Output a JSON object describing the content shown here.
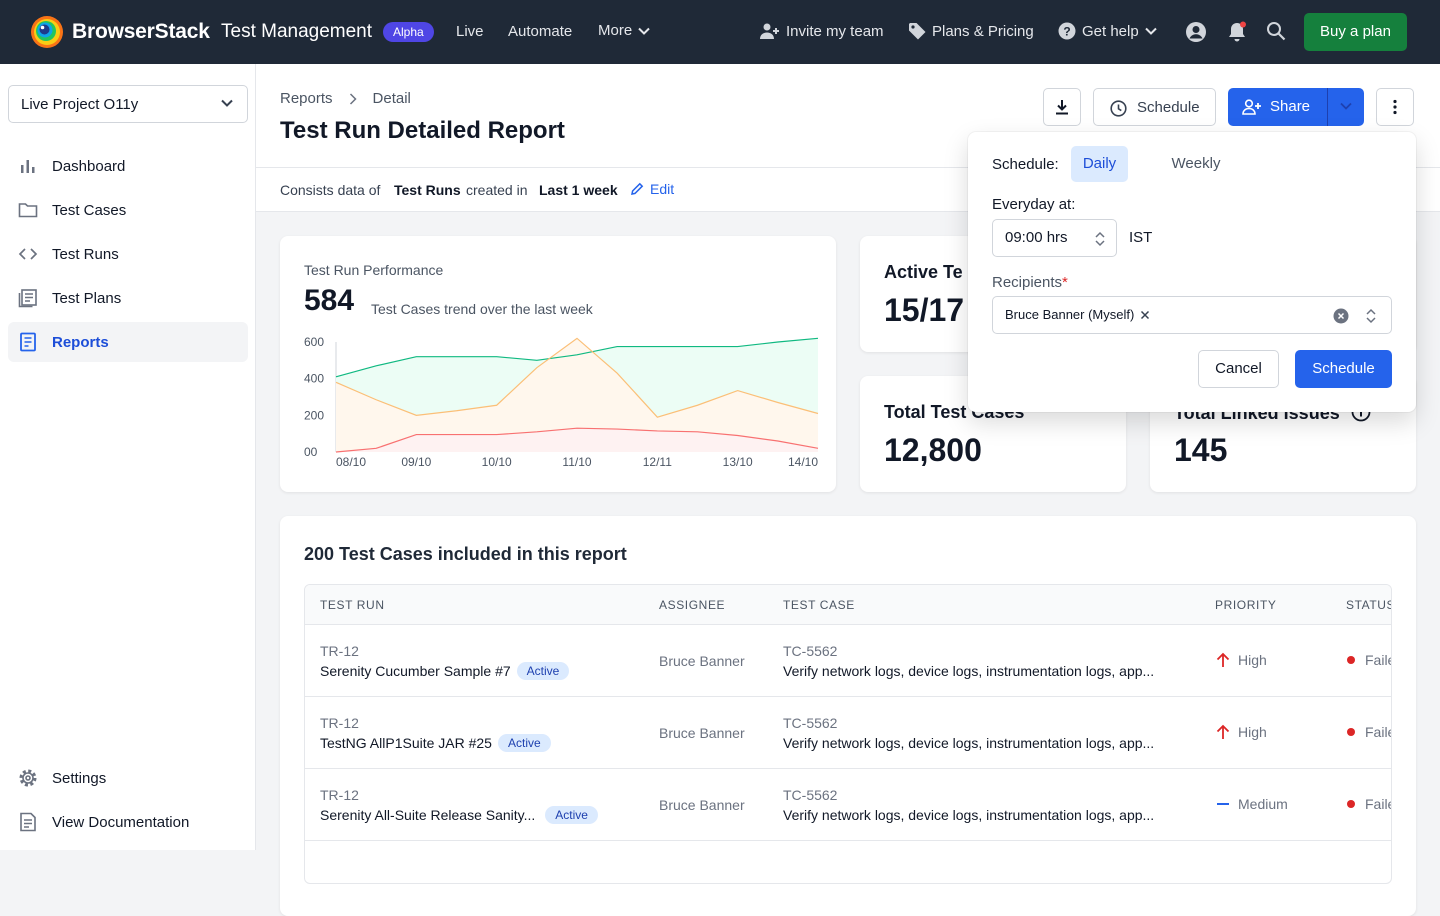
{
  "nav": {
    "brand": "BrowserStack",
    "product": "Test Management",
    "badge": "Alpha",
    "links": [
      "Live",
      "Automate",
      "More"
    ],
    "invite": "Invite my team",
    "plans": "Plans & Pricing",
    "help": "Get help",
    "buy": "Buy a plan"
  },
  "sidebar": {
    "project": "Live Project O11y",
    "items": [
      {
        "label": "Dashboard",
        "icon": "bar-chart-icon"
      },
      {
        "label": "Test Cases",
        "icon": "folder-icon"
      },
      {
        "label": "Test Runs",
        "icon": "code-icon"
      },
      {
        "label": "Test Plans",
        "icon": "document-list-icon"
      },
      {
        "label": "Reports",
        "icon": "report-icon",
        "active": true
      }
    ],
    "bottom": [
      {
        "label": "Settings",
        "icon": "gear-icon"
      },
      {
        "label": "View Documentation",
        "icon": "document-icon"
      }
    ]
  },
  "header": {
    "crumbs": [
      "Reports",
      "Detail"
    ],
    "title": "Test Run Detailed Report",
    "schedule": "Schedule",
    "share": "Share"
  },
  "filter": {
    "prefix": "Consists data of",
    "entity": "Test Runs",
    "mid": "created in",
    "range": "Last 1 week",
    "edit": "Edit"
  },
  "performance": {
    "label": "Test Run Performance",
    "value": "584",
    "subtitle": "Test Cases trend over the last week"
  },
  "chart_data": {
    "type": "area",
    "title": "Test Run Performance",
    "categories": [
      "08/10",
      "09/10",
      "10/10",
      "11/10",
      "12/11",
      "13/10",
      "14/10"
    ],
    "x_points": [
      0,
      0.5,
      1,
      1.5,
      2,
      2.5,
      3,
      3.5,
      4,
      4.5,
      5,
      5.5,
      6
    ],
    "yticks": [
      "600",
      "400",
      "200",
      "00"
    ],
    "ylim": [
      0,
      600
    ],
    "grid": false,
    "series": [
      {
        "color": "#10b981",
        "fill": "#ecfdf5",
        "values": [
          410,
          470,
          520,
          520,
          520,
          500,
          530,
          575,
          575,
          575,
          575,
          600,
          620
        ]
      },
      {
        "color": "#fbbf77",
        "fill": "#fff7ed",
        "values": [
          380,
          285,
          200,
          225,
          255,
          460,
          620,
          430,
          190,
          255,
          335,
          270,
          210
        ]
      },
      {
        "color": "#f87171",
        "fill": "#fef2f2",
        "values": [
          0,
          20,
          95,
          95,
          95,
          110,
          130,
          125,
          115,
          110,
          90,
          60,
          20
        ]
      }
    ]
  },
  "stats": {
    "active_label": "Active Te",
    "active_value": "15/17",
    "total_label": "Total Test Cases",
    "total_value": "12,800",
    "linked_label": "Total Linked Issues",
    "linked_value": "145"
  },
  "table": {
    "title": "200 Test Cases included in this report",
    "headers": [
      "TEST RUN",
      "ASSIGNEE",
      "TEST CASE",
      "PRIORITY",
      "STATUS"
    ],
    "rows": [
      {
        "run_id": "TR-12",
        "run_name": "Serenity Cucumber Sample #7",
        "badge": "Active",
        "assignee": "Bruce Banner",
        "tc_id": "TC-5562",
        "tc_name": "Verify network logs, device logs, instrumentation logs, app...",
        "priority": "High",
        "priority_icon": "arrow-up-icon",
        "status": "Faile"
      },
      {
        "run_id": "TR-12",
        "run_name": "TestNG AllP1Suite JAR #25",
        "badge": "Active",
        "assignee": "Bruce Banner",
        "tc_id": "TC-5562",
        "tc_name": "Verify network logs, device logs, instrumentation logs, app...",
        "priority": "High",
        "priority_icon": "arrow-up-icon",
        "status": "Faile"
      },
      {
        "run_id": "TR-12",
        "run_name": "Serenity All-Suite Release Sanity...",
        "badge": "Active",
        "assignee": "Bruce Banner",
        "tc_id": "TC-5562",
        "tc_name": "Verify network logs, device logs, instrumentation logs, app...",
        "priority": "Medium",
        "priority_icon": "dash-icon",
        "status": "Faile"
      }
    ]
  },
  "popover": {
    "schedule_label": "Schedule:",
    "daily": "Daily",
    "weekly": "Weekly",
    "everyday": "Everyday at:",
    "time": "09:00 hrs",
    "tz": "IST",
    "recipients": "Recipients",
    "required": "*",
    "chip": "Bruce Banner (Myself)",
    "cancel": "Cancel",
    "submit": "Schedule"
  },
  "colors": {
    "nav_bg": "#1f2937",
    "primary": "#2563eb",
    "buy": "#15803d",
    "alpha": "#4f46e5",
    "failed": "#dc2626",
    "high": "#dc2626",
    "medium": "#2563eb"
  }
}
